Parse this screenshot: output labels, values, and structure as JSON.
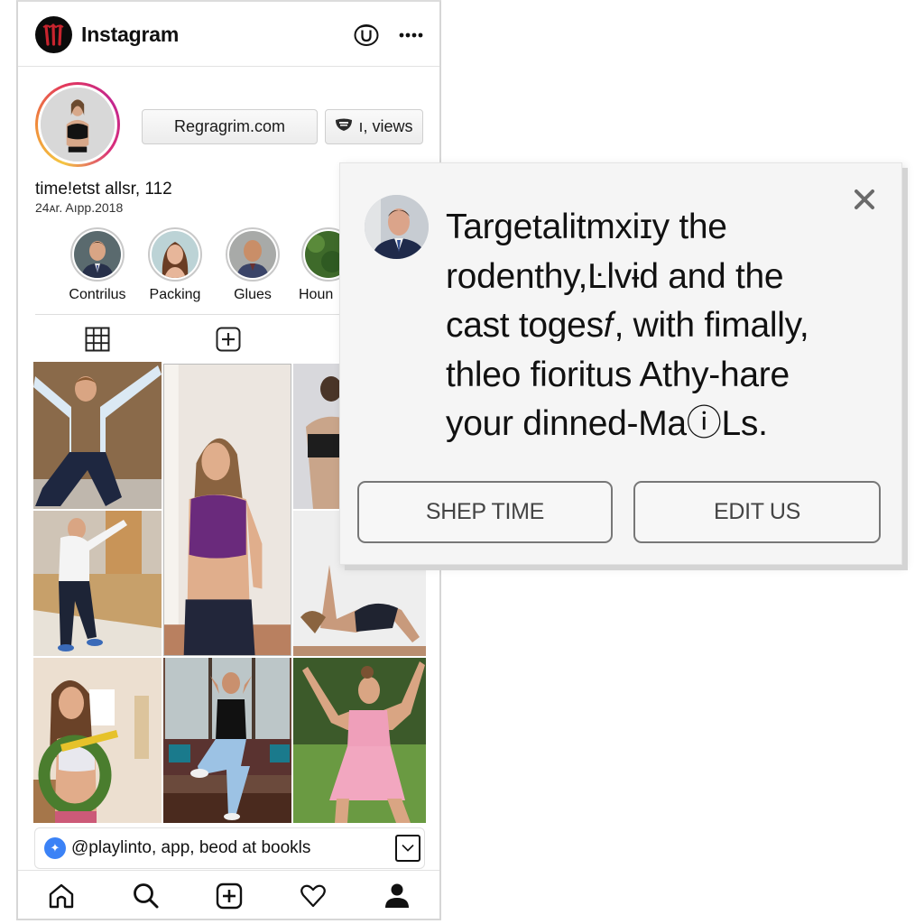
{
  "app": {
    "title": "Instagram",
    "logo_icon": "monster-claw-logo-icon",
    "header_icons": [
      "circled-u-icon",
      "more-dots-icon"
    ]
  },
  "profile": {
    "avatar": "profile-photo-woman-black-sports-bra",
    "website_button": "Regragrim.com",
    "views_button": "ı, views",
    "views_icon": "mask-icon",
    "name_line": "time!etst allsr, 112",
    "date_line": "24ᴀr. Aıpp.2018"
  },
  "stories": [
    {
      "label": "Contrilus",
      "photo": "man-in-suit"
    },
    {
      "label": "Packing",
      "photo": "woman-brown-hair"
    },
    {
      "label": "Glues",
      "photo": "bald-man-smiling"
    },
    {
      "label": "Houn",
      "photo": "person-outdoors-greenery"
    }
  ],
  "tabs": [
    {
      "name": "grid",
      "icon": "grid-icon"
    },
    {
      "name": "add",
      "icon": "plus-square-icon"
    }
  ],
  "grid_posts": [
    {
      "desc": "woman-arms-raised-squat",
      "colors": [
        "#8a6a4a",
        "#dbe9f4",
        "#1e2740"
      ]
    },
    {
      "desc": "woman-purple-sports-bra",
      "colors": [
        "#ece6e0",
        "#6a2a7c",
        "#22263a"
      ]
    },
    {
      "desc": "person-black-top-stretch",
      "colors": [
        "#d8d8dc",
        "#1d1d1d",
        "#c9a58a"
      ]
    },
    {
      "desc": "woman-white-shirt-lunge",
      "colors": [
        "#c7a06a",
        "#f4f4f4",
        "#1d2436"
      ]
    },
    {
      "desc": "woman-aerial-pose",
      "colors": [
        "#eeeeee",
        "#1f2330",
        "#c89a7c"
      ]
    },
    {
      "desc": "woman-green-ring-gym",
      "colors": [
        "#ecdfd0",
        "#4a7d2e",
        "#e8e8ee"
      ]
    },
    {
      "desc": "woman-black-tank-knee-raise",
      "colors": [
        "#8a8a88",
        "#111111",
        "#9cc2e4"
      ]
    },
    {
      "desc": "woman-pink-dress-outdoors",
      "colors": [
        "#3c5a2a",
        "#ef9fba",
        "#5f8a3a"
      ]
    }
  ],
  "bottom_strip": {
    "badge_icon": "sparkle-badge-icon",
    "text": "@playlinto, app, beod at bookls",
    "action_icon": "chevron-down-box-icon"
  },
  "bottom_nav": [
    {
      "name": "home",
      "icon": "home-icon"
    },
    {
      "name": "search",
      "icon": "search-icon"
    },
    {
      "name": "create",
      "icon": "plus-square-icon"
    },
    {
      "name": "activity",
      "icon": "heart-icon"
    },
    {
      "name": "profile",
      "icon": "person-icon"
    }
  ],
  "popup": {
    "avatar": "man-in-suit-portrait",
    "close_icon": "close-icon",
    "lines": [
      "Targetalitmxiɪy the",
      "rodenthy,Ŀlvɨd and the",
      "cast toges𝑓, with fimally,",
      "thleo fioritus Athy-hare",
      "your dinned-MaⓘLs."
    ],
    "buttons": [
      "SHEP TIME",
      "EDIT US"
    ]
  }
}
